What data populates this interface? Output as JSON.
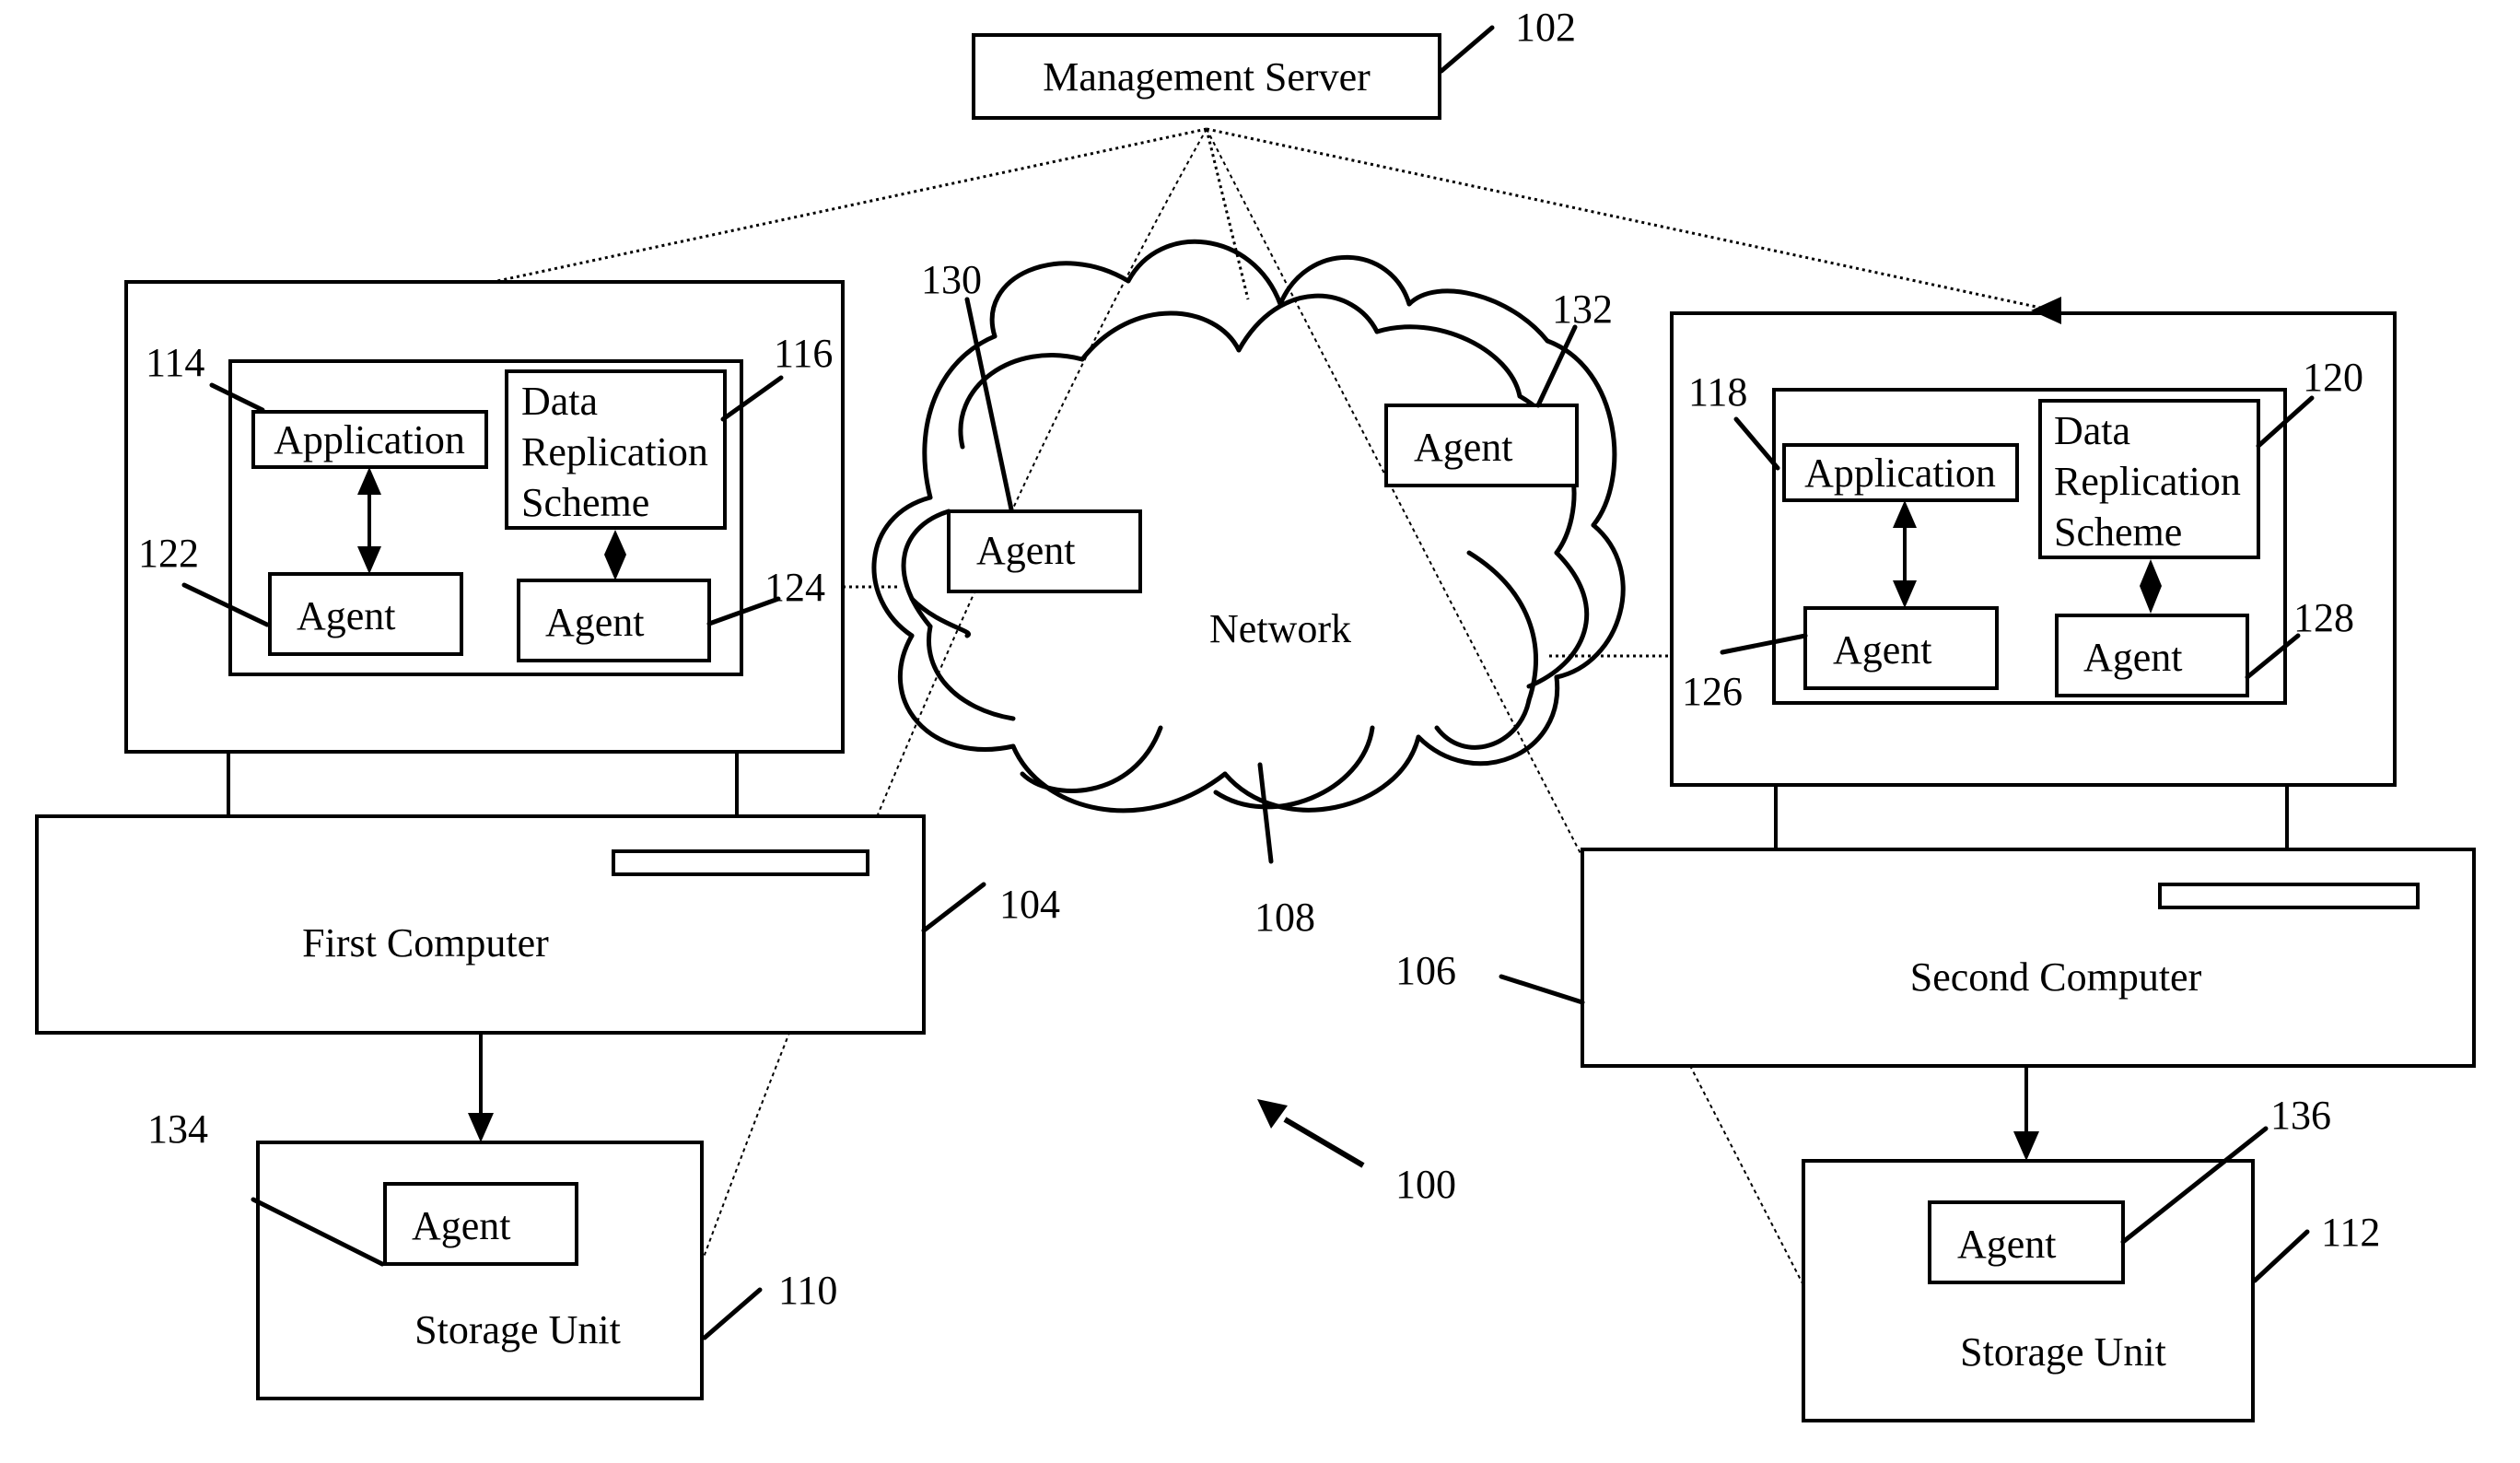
{
  "figure": {
    "ref": "100",
    "colors": {
      "ink": "#000000",
      "paper": "#ffffff"
    }
  },
  "management_server": {
    "label": "Management Server",
    "ref": "102"
  },
  "network": {
    "label": "Network",
    "ref": "108"
  },
  "network_agents": [
    {
      "label": "Agent",
      "ref": "130"
    },
    {
      "label": "Agent",
      "ref": "132"
    }
  ],
  "first_computer": {
    "label": "First Computer",
    "ref": "104",
    "application": {
      "label": "Application",
      "ref": "114"
    },
    "replication_scheme": {
      "lines": [
        "Data",
        "Replication",
        "Scheme"
      ],
      "ref": "116"
    },
    "app_agent": {
      "label": "Agent",
      "ref": "122"
    },
    "scheme_agent": {
      "label": "Agent",
      "ref": "124"
    }
  },
  "second_computer": {
    "label": "Second Computer",
    "ref": "106",
    "application": {
      "label": "Application",
      "ref": "118"
    },
    "replication_scheme": {
      "lines": [
        "Data",
        "Replication",
        "Scheme"
      ],
      "ref": "120"
    },
    "app_agent": {
      "label": "Agent",
      "ref": "126"
    },
    "scheme_agent": {
      "label": "Agent",
      "ref": "128"
    }
  },
  "first_storage": {
    "label": "Storage Unit",
    "ref": "110",
    "agent": {
      "label": "Agent",
      "ref": "134"
    }
  },
  "second_storage": {
    "label": "Storage Unit",
    "ref": "112",
    "agent": {
      "label": "Agent",
      "ref": "136"
    }
  }
}
